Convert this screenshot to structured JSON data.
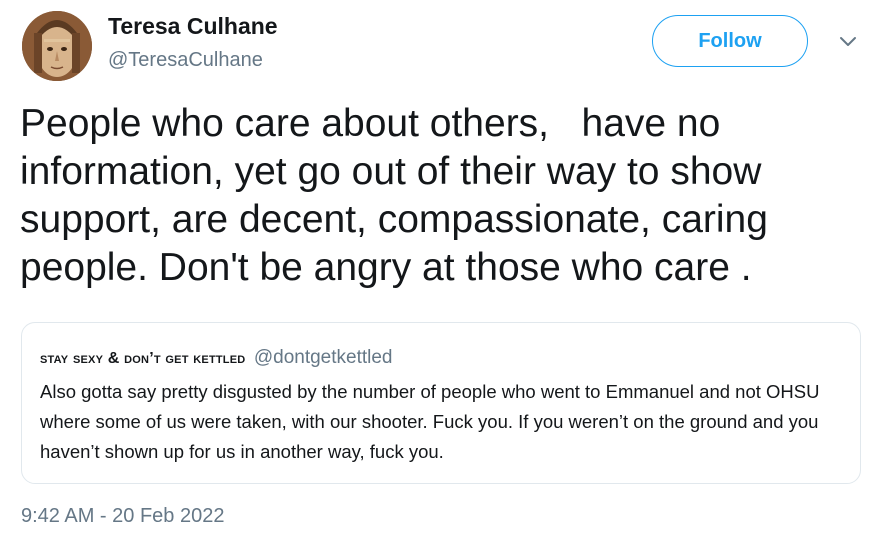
{
  "author": {
    "display_name": "Teresa Culhane",
    "handle": "@TeresaCulhane",
    "avatar_icon": "avatar-portrait"
  },
  "follow_label": "Follow",
  "more_icon": "chevron-down-icon",
  "tweet_text": "People who care about others,   have no information, yet go out of their way to show support, are decent, compassionate, caring people. Don't be angry at those who care .",
  "quoted_tweet": {
    "display_name": "STAY SEXY & DON’T GET KETTLED",
    "handle": "@dontgetkettled",
    "text": "Also gotta say pretty disgusted by the number of people who went to Emmanuel and not OHSU where some of us were taken, with our shooter. Fuck you. If you weren’t on the ground and you haven’t shown up for us in another way, fuck you."
  },
  "timestamp": "9:42 AM - 20 Feb 2022",
  "colors": {
    "accent": "#1da1f2",
    "text": "#14171a",
    "muted": "#657786",
    "border": "#e1e8ed"
  }
}
